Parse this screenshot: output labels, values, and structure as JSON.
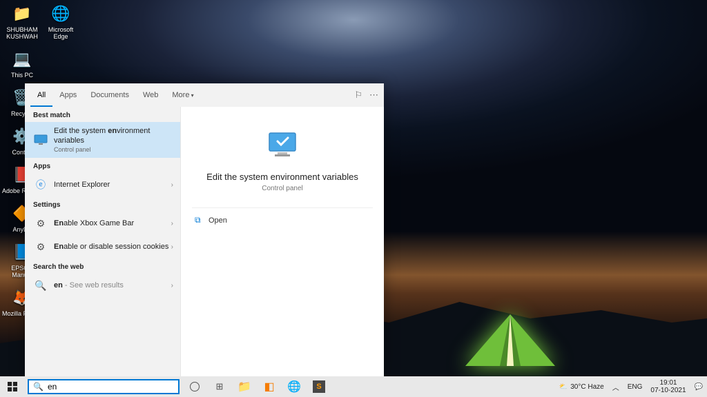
{
  "desktop": {
    "icons": [
      {
        "label": "SHUBHAM KUSHWAH",
        "glyph": "📁"
      },
      {
        "label": "Microsoft Edge",
        "glyph": "🌐"
      },
      {
        "label": "This PC",
        "glyph": "💻"
      },
      {
        "label": "Recycle",
        "glyph": "🗑️"
      },
      {
        "label": "Control",
        "glyph": "⚙️"
      },
      {
        "label": "Adobe Reader",
        "glyph": "📕"
      },
      {
        "label": "AnyDe",
        "glyph": "🔶"
      },
      {
        "label": "EPSON Manual",
        "glyph": "📘"
      },
      {
        "label": "Mozilla Firefox",
        "glyph": "🦊"
      }
    ]
  },
  "search": {
    "query": "en",
    "tabs": [
      "All",
      "Apps",
      "Documents",
      "Web",
      "More"
    ],
    "active_tab": "All",
    "sections": {
      "best_match": "Best match",
      "apps": "Apps",
      "settings": "Settings",
      "web": "Search the web"
    },
    "best_match": {
      "title_pre": "Edit the system ",
      "title_bold": "en",
      "title_post": "vironment variables",
      "sub": "Control panel"
    },
    "apps_list": [
      {
        "label": "Internet Explorer",
        "icon": "ie"
      }
    ],
    "settings_list": [
      {
        "pre": "",
        "bold": "En",
        "post": "able Xbox Game Bar",
        "icon": "gear"
      },
      {
        "pre": "",
        "bold": "En",
        "post": "able or disable session cookies",
        "icon": "gear"
      }
    ],
    "web_list": [
      {
        "pre": "",
        "bold": "en",
        "post": "",
        "hint": " - See web results",
        "icon": "search"
      }
    ],
    "preview": {
      "title": "Edit the system environment variables",
      "sub": "Control panel",
      "action": "Open"
    }
  },
  "taskbar": {
    "weather": "30°C  Haze",
    "lang": "ENG",
    "time": "19:01",
    "date": "07-10-2021"
  }
}
